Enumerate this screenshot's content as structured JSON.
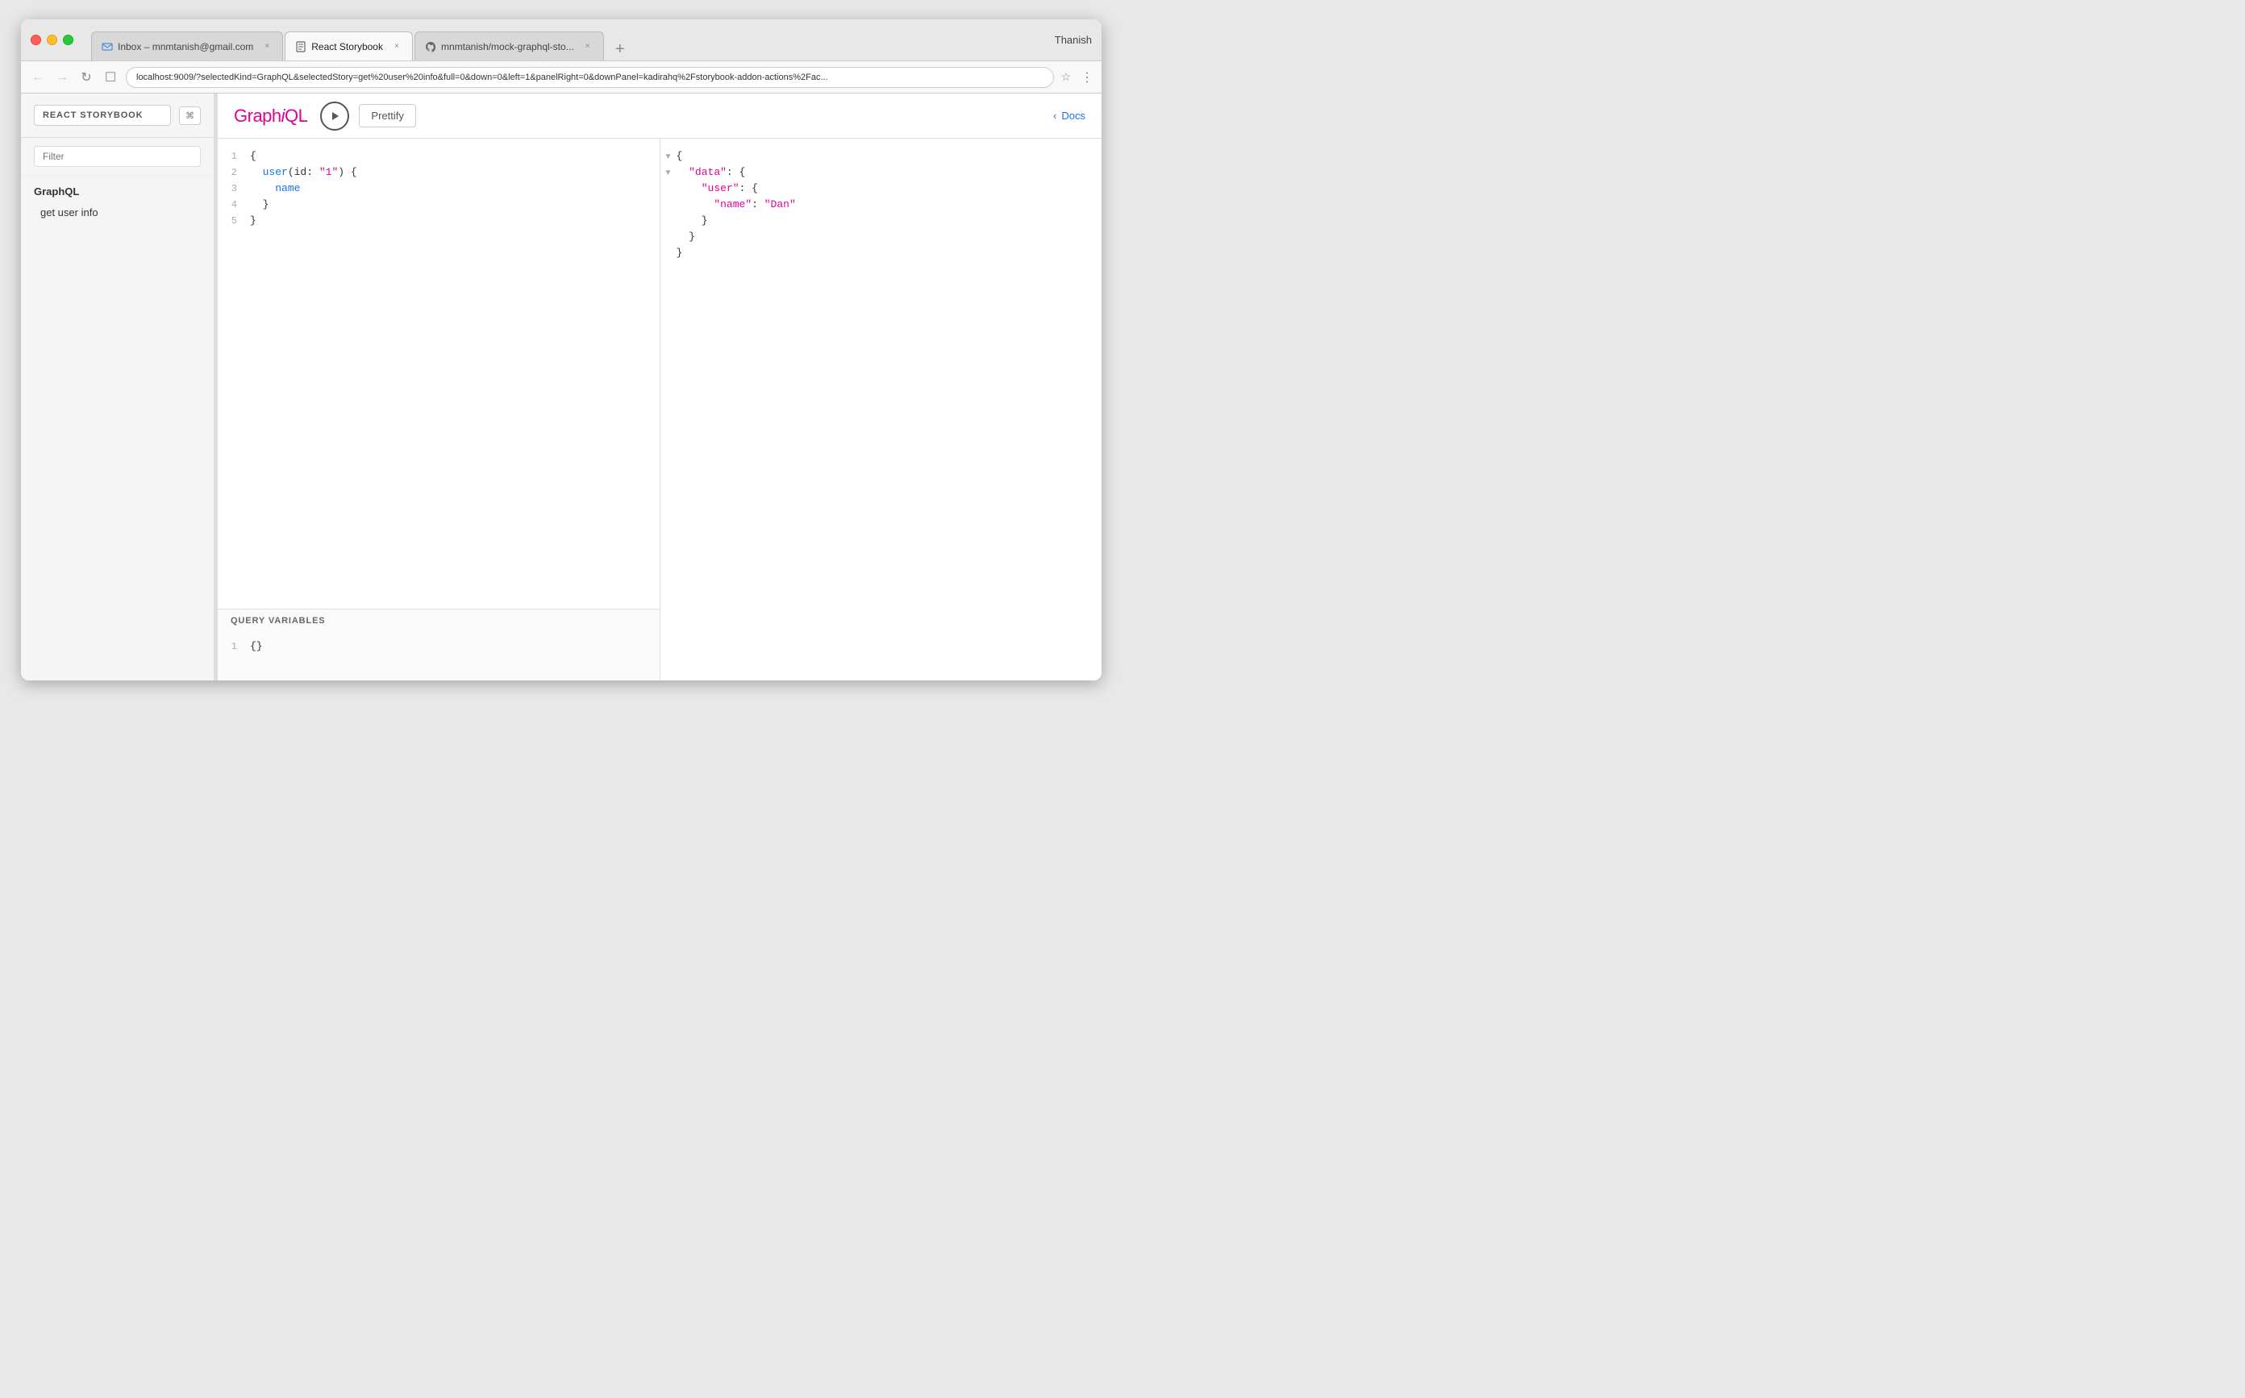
{
  "browser": {
    "traffic_lights": [
      "red",
      "yellow",
      "green"
    ],
    "tabs": [
      {
        "id": "tab-inbox",
        "label": "Inbox – mnmtanish@gmail.com",
        "icon": "mail-icon",
        "active": false,
        "closable": true
      },
      {
        "id": "tab-storybook",
        "label": "React Storybook",
        "icon": "book-icon",
        "active": true,
        "closable": true
      },
      {
        "id": "tab-github",
        "label": "mnmtanish/mock-graphql-sto...",
        "icon": "github-icon",
        "active": false,
        "closable": true
      },
      {
        "id": "tab-new",
        "label": "",
        "icon": "new-tab-icon",
        "active": false,
        "closable": false
      }
    ],
    "address_bar": {
      "url": "localhost:9009/?selectedKind=GraphQL&selectedStory=get%20user%20info&full=0&down=0&left=1&panelRight=0&downPanel=kadirahq%2Fstorybook-addon-actions%2Fac...",
      "back_disabled": false,
      "forward_disabled": true
    },
    "user": "Thanish"
  },
  "sidebar": {
    "title": "REACT STORYBOOK",
    "shortcut": "⌘",
    "filter": {
      "placeholder": "Filter",
      "value": ""
    },
    "sections": [
      {
        "title": "GraphQL",
        "items": [
          {
            "label": "get user info",
            "active": true
          }
        ]
      }
    ]
  },
  "graphiql": {
    "logo": "GraphiQL",
    "logo_italic_char": "i",
    "run_button_label": "▶",
    "prettify_label": "Prettify",
    "docs_label": "Docs",
    "query_editor": {
      "lines": [
        {
          "number": 1,
          "content": "{",
          "tokens": [
            {
              "type": "brace",
              "text": "{"
            }
          ]
        },
        {
          "number": 2,
          "content": "  user(id: \"1\") {",
          "tokens": [
            {
              "type": "field",
              "text": "user"
            },
            {
              "type": "plain",
              "text": "(id: "
            },
            {
              "type": "string",
              "text": "\"1\""
            },
            {
              "type": "plain",
              "text": ") {"
            }
          ]
        },
        {
          "number": 3,
          "content": "    name",
          "tokens": [
            {
              "type": "field",
              "text": "name"
            }
          ]
        },
        {
          "number": 4,
          "content": "  }",
          "tokens": [
            {
              "type": "plain",
              "text": "}"
            }
          ]
        },
        {
          "number": 5,
          "content": "}",
          "tokens": [
            {
              "type": "brace",
              "text": "}"
            }
          ]
        }
      ]
    },
    "query_variables": {
      "header": "QUERY VARIABLES",
      "lines": [
        {
          "number": 1,
          "content": "{}"
        }
      ]
    },
    "response": {
      "lines": [
        {
          "indent": 0,
          "content": "{"
        },
        {
          "indent": 2,
          "content": "\"data\": {"
        },
        {
          "indent": 4,
          "content": "\"user\": {"
        },
        {
          "indent": 6,
          "content": "\"name\": \"Dan\""
        },
        {
          "indent": 4,
          "content": "}"
        },
        {
          "indent": 2,
          "content": "}"
        },
        {
          "indent": 0,
          "content": "}"
        }
      ]
    }
  }
}
